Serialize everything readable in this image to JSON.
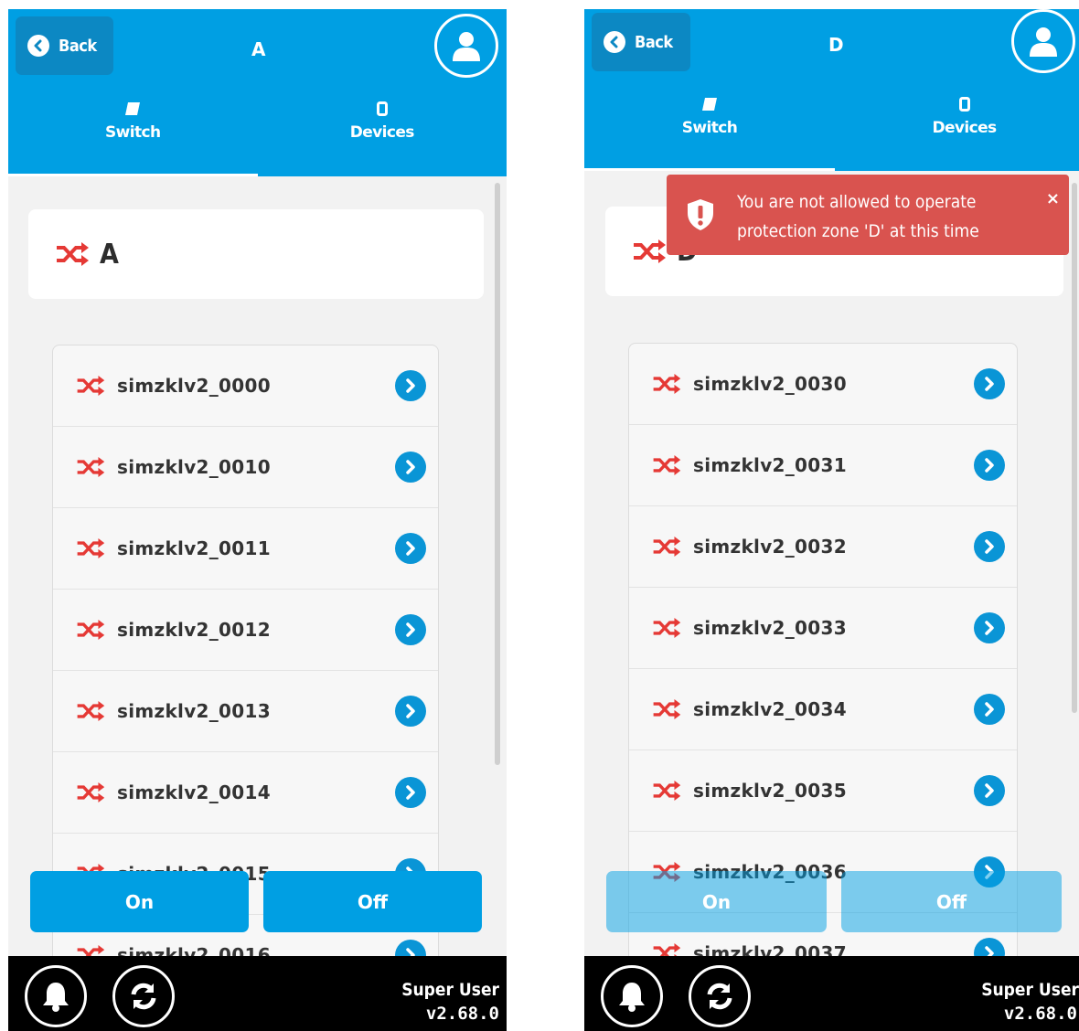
{
  "colors": {
    "header": "#009fe3",
    "back_button": "#0c88c3",
    "switch_icon": "#e53935",
    "chevron": "#0a95d6",
    "toast": "#d9534f",
    "footer": "#000000"
  },
  "left": {
    "header": {
      "back_label": "Back",
      "zone_letter": "A"
    },
    "tabs": [
      {
        "label": "Switch",
        "icon": "switch-icon",
        "active": true
      },
      {
        "label": "Devices",
        "icon": "device-icon",
        "active": false
      }
    ],
    "title": "A",
    "items": [
      "simzklv2_0000",
      "simzklv2_0010",
      "simzklv2_0011",
      "simzklv2_0012",
      "simzklv2_0013",
      "simzklv2_0014",
      "simzklv2_0015",
      "simzklv2_0016"
    ],
    "buttons": {
      "on": "On",
      "off": "Off",
      "enabled": true
    },
    "footer": {
      "user": "Super User",
      "version": "v2.68.0"
    }
  },
  "right": {
    "header": {
      "back_label": "Back",
      "zone_letter": "D"
    },
    "tabs": [
      {
        "label": "Switch",
        "icon": "switch-icon",
        "active": true
      },
      {
        "label": "Devices",
        "icon": "device-icon",
        "active": false
      }
    ],
    "title": "D",
    "items": [
      "simzklv2_0030",
      "simzklv2_0031",
      "simzklv2_0032",
      "simzklv2_0033",
      "simzklv2_0034",
      "simzklv2_0035",
      "simzklv2_0036",
      "simzklv2_0037"
    ],
    "buttons": {
      "on": "On",
      "off": "Off",
      "enabled": false
    },
    "toast": {
      "message": "You are not allowed to operate protection zone 'D' at this time",
      "close": "×"
    },
    "footer": {
      "user": "Super User",
      "version": "v2.68.0"
    }
  }
}
